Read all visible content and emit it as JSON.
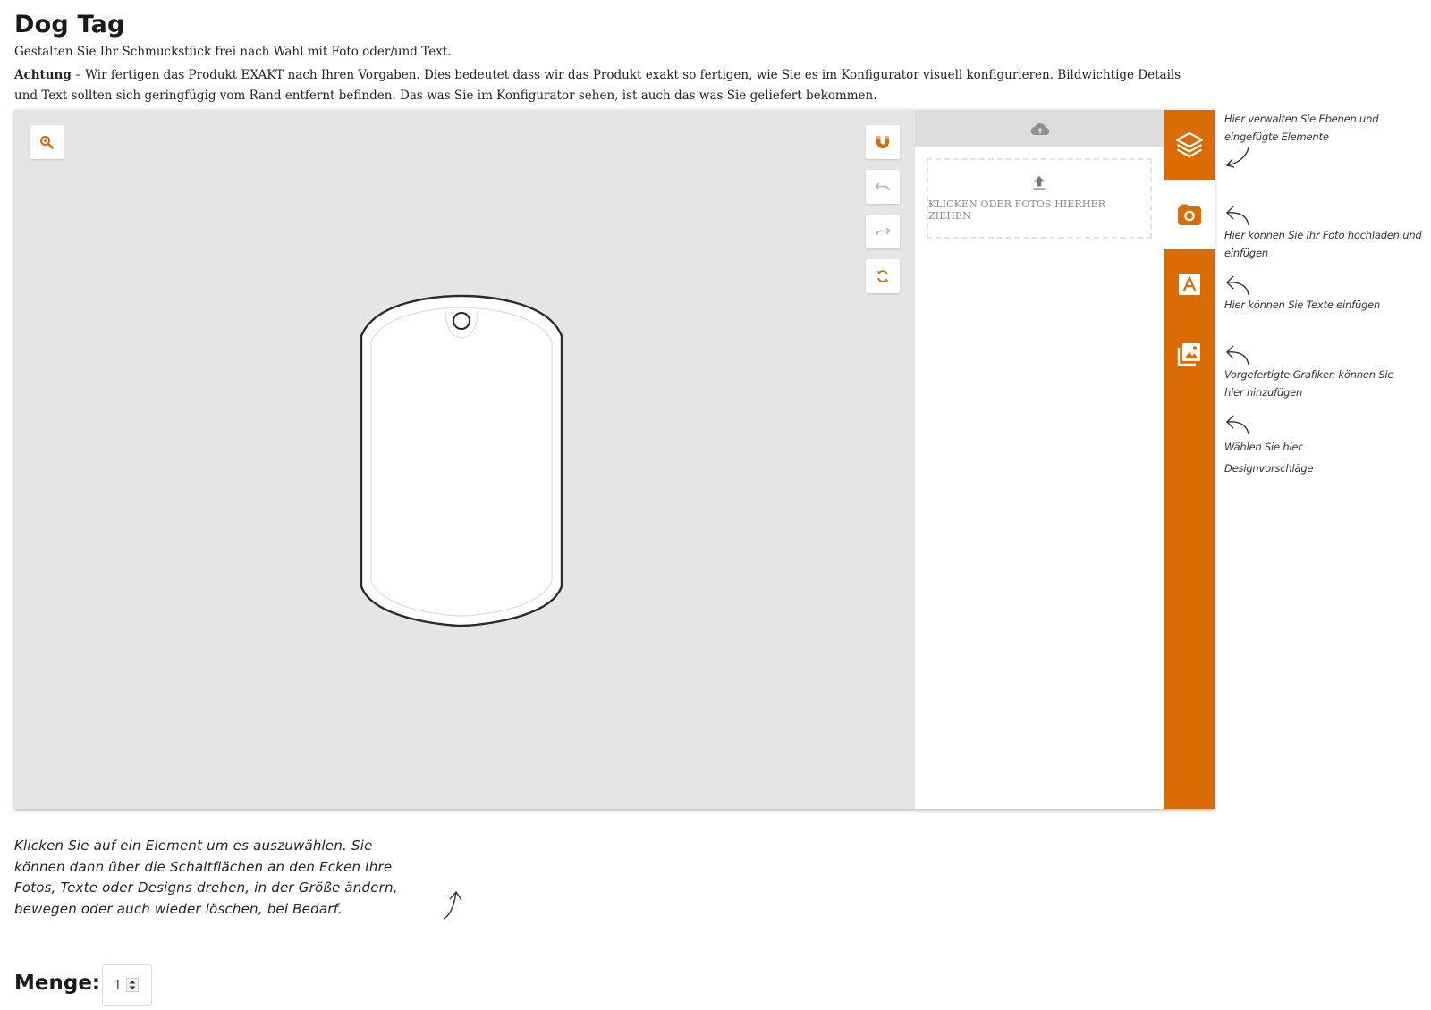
{
  "header": {
    "title": "Dog Tag",
    "subtitle": "Gestalten Sie Ihr Schmuckstück frei nach Wahl mit Foto oder/und Text.",
    "notice_label": "Achtung",
    "notice_text": " – Wir fertigen das Produkt EXAKT nach Ihren Vorgaben. Dies bedeutet dass wir das Produkt exakt so fertigen, wie Sie es im Konfigurator visuell konfigurieren. Bildwichtige Details und Text sollten sich geringfügig vom Rand entfernt befinden. Das was Sie im Konfigurator sehen, ist auch das was Sie geliefert bekommen."
  },
  "toolbar": {
    "zoom": "zoom-in-icon",
    "snap": "magnet-icon",
    "undo": "undo-icon",
    "redo": "redo-icon",
    "reset": "reset-icon"
  },
  "upload": {
    "header_icon": "cloud-upload-icon",
    "dropzone_label": "KLICKEN ODER FOTOS HIERHER ZIEHEN"
  },
  "tabs": [
    {
      "name": "layers",
      "icon": "layers-icon",
      "active": false
    },
    {
      "name": "photo",
      "icon": "camera-icon",
      "active": true
    },
    {
      "name": "text",
      "icon": "text-icon",
      "active": false
    },
    {
      "name": "graphics",
      "icon": "images-icon",
      "active": false
    }
  ],
  "hints": {
    "layers": "Hier verwalten Sie Ebenen und eingefügte Elemente",
    "photo": "Hier können Sie Ihr Foto hochladen und einfügen",
    "text": "Hier können Sie Texte einfügen",
    "graphics": "Vorgefertigte Grafiken können Sie hier hinzufügen",
    "designs": "Wählen Sie hier Designvorschläge"
  },
  "bottom_hint": "Klicken Sie auf ein Element um es auszuwählen. Sie können dann über die Schaltflächen an den Ecken Ihre Fotos, Texte oder Designs drehen, in der Größe ändern, bewegen oder auch wieder löschen, bei Bedarf.",
  "quantity": {
    "label": "Menge:",
    "value": "1"
  },
  "colors": {
    "accent": "#db6b05",
    "stage_bg": "#e5e5e5"
  }
}
